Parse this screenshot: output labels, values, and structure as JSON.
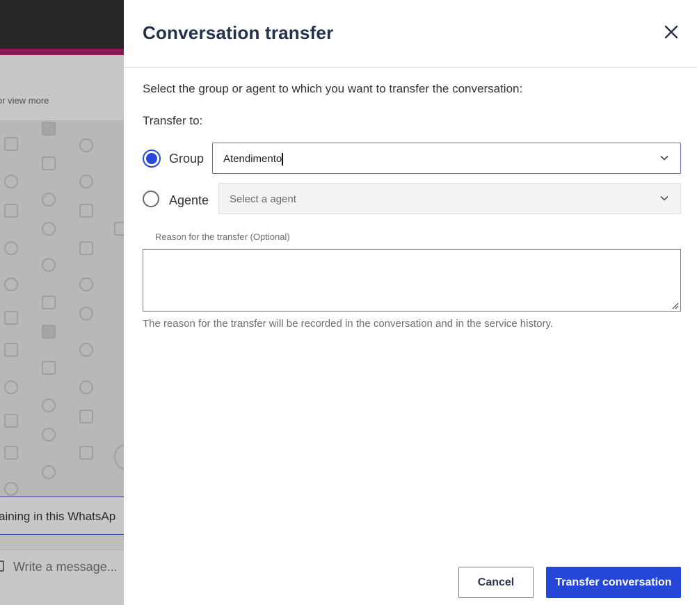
{
  "background": {
    "view_more": "or view more",
    "banner_text": "aining in this WhatsAp",
    "composer_placeholder": "Write a message..."
  },
  "modal": {
    "title": "Conversation transfer",
    "instruction": "Select the group or agent to which you want to transfer the conversation:",
    "transfer_to_label": "Transfer to:",
    "options": [
      {
        "label": "Group",
        "checked": true,
        "value": "Atendimento"
      },
      {
        "label": "Agente",
        "checked": false,
        "placeholder": "Select a agent"
      }
    ],
    "reason_label": "Reason for the transfer (Optional)",
    "reason_value": "",
    "reason_help": "The reason for the transfer will be recorded in the conversation and in the service history.",
    "cancel_label": "Cancel",
    "transfer_label": "Transfer conversation"
  },
  "colors": {
    "accent_blue": "#2447d8",
    "title_navy": "#26304a",
    "top_bar_pink": "#b21f6e",
    "focused_border": "#7a5fb8"
  },
  "icons": {
    "close": "close-icon",
    "select_chevron": "chevron-down-icon",
    "resize": "resize-grip-icon"
  }
}
